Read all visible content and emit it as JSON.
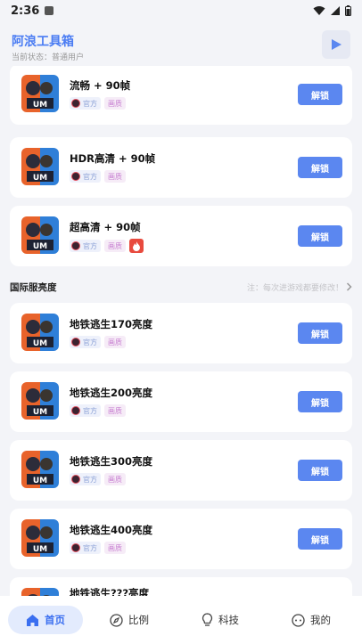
{
  "status_bar": {
    "time": "2:36"
  },
  "header": {
    "title": "阿浪工具箱",
    "subtitle": "当前状态：普通用户"
  },
  "cards_top": [
    {
      "name": "流畅 + 90帧",
      "official": "官方",
      "quality": "画质",
      "hot": false,
      "button": "解锁"
    },
    {
      "name": "HDR高清 + 90帧",
      "official": "官方",
      "quality": "画质",
      "hot": false,
      "button": "解锁"
    },
    {
      "name": "超高清 + 90帧",
      "official": "官方",
      "quality": "画质",
      "hot": true,
      "button": "解锁"
    }
  ],
  "section": {
    "label": "国际服亮度",
    "note": "注：每次进游戏都要修改！"
  },
  "cards_bottom": [
    {
      "name": "地铁逃生170亮度",
      "official": "官方",
      "quality": "画质",
      "button": "解锁"
    },
    {
      "name": "地铁逃生200亮度",
      "official": "官方",
      "quality": "画质",
      "button": "解锁"
    },
    {
      "name": "地铁逃生300亮度",
      "official": "官方",
      "quality": "画质",
      "button": "解锁"
    },
    {
      "name": "地铁逃生400亮度",
      "official": "官方",
      "quality": "画质",
      "button": "解锁"
    },
    {
      "name": "地铁逃生???亮度"
    }
  ],
  "tabbar": {
    "home": "首页",
    "ratio": "比例",
    "tech": "科技",
    "mine": "我的"
  },
  "colors": {
    "accent": "#5b87f0",
    "title": "#4a7cf3",
    "hot": "#e84a3e"
  }
}
